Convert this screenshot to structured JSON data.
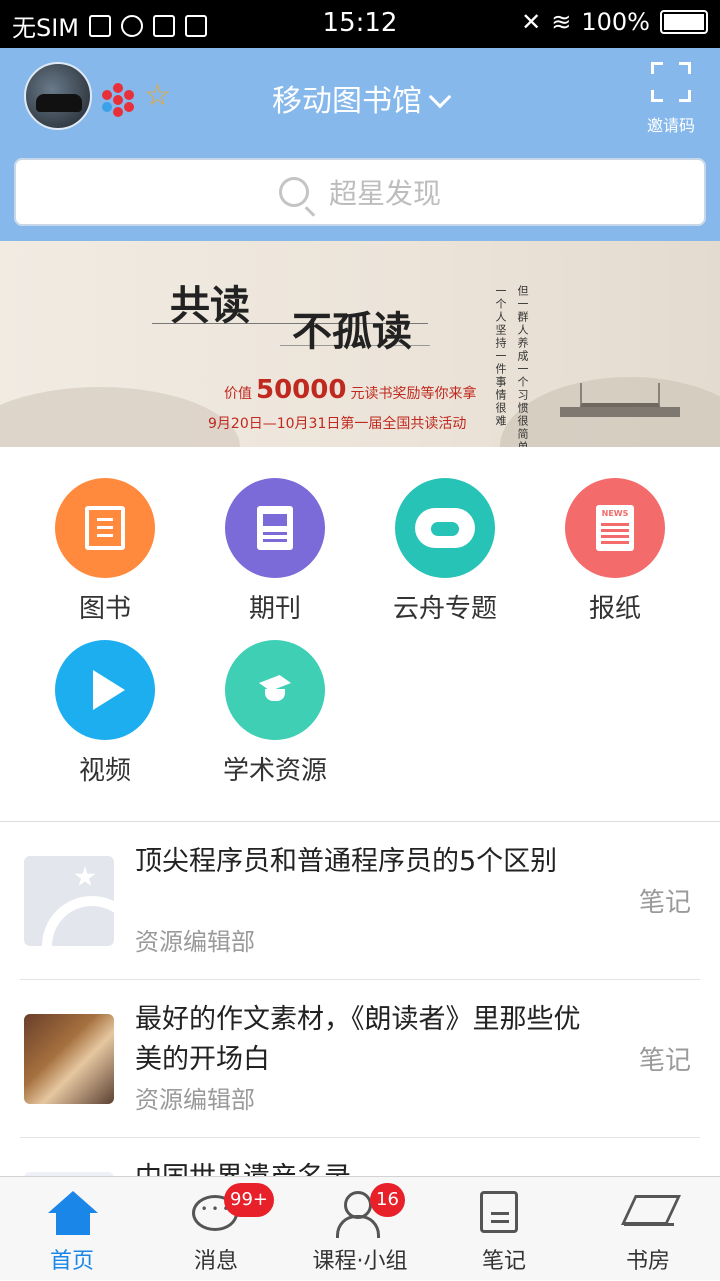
{
  "status_bar": {
    "carrier": "无SIM",
    "time": "15:12",
    "battery": "100%"
  },
  "header": {
    "title": "移动图书馆",
    "invite_label": "邀请码",
    "search_placeholder": "超星发现"
  },
  "banner": {
    "heading_1": "共读",
    "heading_2": "不孤读",
    "value_prefix": "价值",
    "value_amount": "50000",
    "value_suffix": "元读书奖励等你来拿",
    "date_line": "9月20日—10月31日第一届全国共读活动",
    "vertical_text": [
      "一个人坚持一件事情很难",
      "但一群人养成一个习惯很简单"
    ]
  },
  "categories": [
    {
      "label": "图书",
      "icon": "book-icon",
      "color": "#ff8a3d"
    },
    {
      "label": "期刊",
      "icon": "magazine-icon",
      "color": "#7a6bd8"
    },
    {
      "label": "云舟专题",
      "icon": "cloud-icon",
      "color": "#27c3b6"
    },
    {
      "label": "报纸",
      "icon": "newspaper-icon",
      "color": "#f36b6b"
    },
    {
      "label": "视频",
      "icon": "play-icon",
      "color": "#1daeef"
    },
    {
      "label": "学术资源",
      "icon": "graduation-cap-icon",
      "color": "#3fcfb5"
    }
  ],
  "feed": [
    {
      "title": "顶尖程序员和普通程序员的5个区别",
      "source": "资源编辑部",
      "action": "笔记"
    },
    {
      "title": "最好的作文素材，《朗读者》里那些优美的开场白",
      "source": "资源编辑部",
      "action": "笔记"
    },
    {
      "title": "中国世界遗产名录",
      "source": "",
      "action": ""
    }
  ],
  "tabs": [
    {
      "label": "首页",
      "icon": "home-icon",
      "badge": ""
    },
    {
      "label": "消息",
      "icon": "message-icon",
      "badge": "99+"
    },
    {
      "label": "课程·小组",
      "icon": "user-icon",
      "badge": "16"
    },
    {
      "label": "笔记",
      "icon": "note-icon",
      "badge": ""
    },
    {
      "label": "书房",
      "icon": "bookshelf-icon",
      "badge": ""
    }
  ],
  "colors": {
    "header_bg": "#86b8ec",
    "accent": "#1a86e8",
    "badge": "#e8202a"
  }
}
